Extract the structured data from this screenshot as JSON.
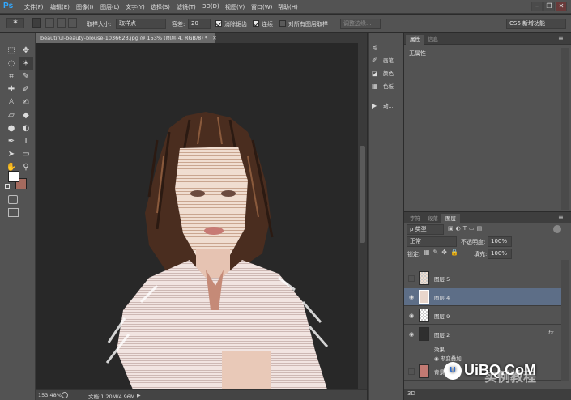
{
  "app": {
    "logo": "Ps"
  },
  "menu": [
    "文件(F)",
    "编辑(E)",
    "图像(I)",
    "图层(L)",
    "文字(Y)",
    "选择(S)",
    "滤镜(T)",
    "3D(D)",
    "视图(V)",
    "窗口(W)",
    "帮助(H)"
  ],
  "window_controls": {
    "minimize": "–",
    "restore": "❐",
    "close": "✕"
  },
  "options": {
    "sample_size_label": "取样大小:",
    "sample_size_value": "取样点",
    "tolerance_label": "容差:",
    "tolerance_value": "20",
    "antialias_label": "消除锯齿",
    "contiguous_label": "连续",
    "all_layers_label": "对所有图层取样",
    "refine_edge_label": "调整边缘...",
    "workspace_value": "CS6 新增功能"
  },
  "document": {
    "tab_title": "beautiful-beauty-blouse-1036623.jpg @ 153% (图层 4, RGB/8) *",
    "tab_close": "✕"
  },
  "status": {
    "zoom": "153.48%",
    "doc_size": "文档:1.20M/4.96M"
  },
  "mid_panel": {
    "items": [
      {
        "label": "",
        "icon": "brush-settings-icon"
      },
      {
        "label": "画笔",
        "icon": "brush-icon"
      },
      {
        "label": "颜色",
        "icon": "color-icon"
      },
      {
        "label": "色板",
        "icon": "swatches-icon"
      },
      {
        "label": "动...",
        "icon": "play-icon"
      }
    ]
  },
  "properties_panel": {
    "tabs": [
      "属性",
      "信息"
    ],
    "content": "无属性"
  },
  "layers_panel": {
    "tabs": [
      "字符",
      "段落",
      "图层"
    ],
    "filter_value": "ρ 类型",
    "blend_mode": "正常",
    "opacity_label": "不透明度:",
    "opacity_value": "100%",
    "lock_label": "锁定:",
    "fill_label": "填充:",
    "fill_value": "100%",
    "layers": [
      {
        "name": "图层 5",
        "thumb": "portrait",
        "visible": false,
        "selected": false
      },
      {
        "name": "图层 4",
        "thumb": "portrait",
        "visible": true,
        "selected": true
      },
      {
        "name": "图层 9",
        "thumb": "transparent",
        "visible": true,
        "selected": false
      },
      {
        "name": "图层 2",
        "thumb": "dark",
        "visible": true,
        "selected": false,
        "fx": "fx"
      }
    ],
    "effects_label": "效果",
    "effect_item": "渐变叠加",
    "last_layer_name": "背景",
    "bottom_label": "3D"
  },
  "watermark": {
    "logo": "U",
    "text": "UiBQ.CoM",
    "overlay_text": "实例教程"
  },
  "colors": {
    "foreground": "#ffffff",
    "background": "#a46a5e",
    "selection": "#5d6e87",
    "accent": "#31a8ff"
  }
}
